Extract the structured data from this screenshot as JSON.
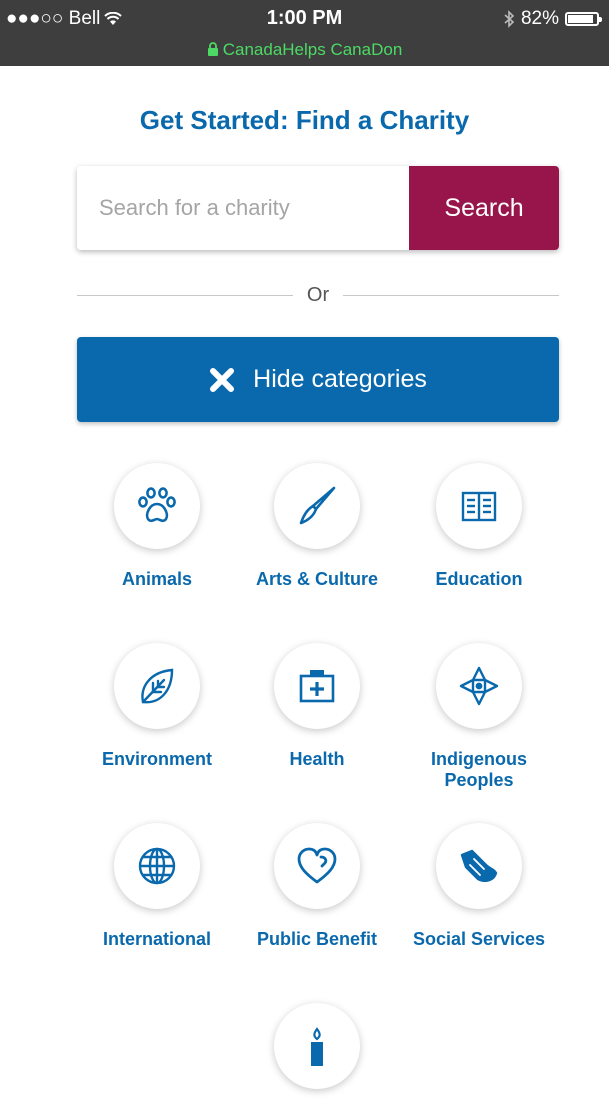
{
  "status_bar": {
    "carrier": "●●●○○ Bell",
    "time": "1:00 PM",
    "battery_percent": "82%",
    "battery_level": 0.82,
    "url": "CanadaHelps CanaDon"
  },
  "heading": "Get Started: Find a Charity",
  "search": {
    "placeholder": "Search for a charity",
    "button_label": "Search"
  },
  "or_label": "Or",
  "hide_button_label": "Hide categories",
  "categories": [
    {
      "label": "Animals",
      "icon": "paw-icon"
    },
    {
      "label": "Arts & Culture",
      "icon": "paintbrush-icon"
    },
    {
      "label": "Education",
      "icon": "book-icon"
    },
    {
      "label": "Environment",
      "icon": "leaf-icon"
    },
    {
      "label": "Health",
      "icon": "first-aid-kit-icon"
    },
    {
      "label": "Indigenous Peoples",
      "icon": "compass-star-icon"
    },
    {
      "label": "International",
      "icon": "globe-icon"
    },
    {
      "label": "Public Benefit",
      "icon": "heart-icon"
    },
    {
      "label": "Social Services",
      "icon": "helping-hand-icon"
    },
    {
      "label": "",
      "icon": "candle-icon"
    }
  ],
  "colors": {
    "brand_blue": "#0a69ad",
    "search_button": "#97154a",
    "status_bar_bg": "#3e3e3e",
    "url_green": "#4cd964"
  }
}
